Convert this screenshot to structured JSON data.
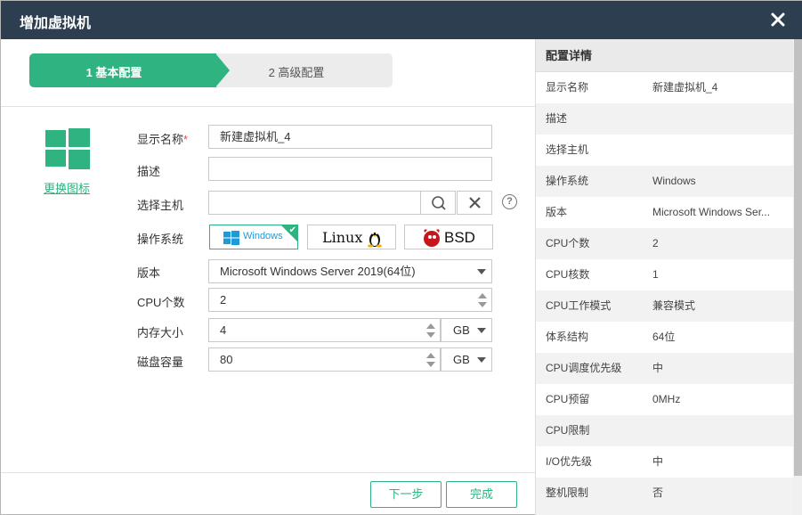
{
  "window": {
    "title": "增加虚拟机"
  },
  "steps": [
    {
      "label": "1 基本配置",
      "active": true
    },
    {
      "label": "2 高级配置",
      "active": false
    }
  ],
  "icon": {
    "name": "windows-icon",
    "change_label": "更换图标"
  },
  "form": {
    "display_name": {
      "label": "显示名称",
      "required_mark": "*",
      "value": "新建虚拟机_4"
    },
    "description": {
      "label": "描述",
      "value": ""
    },
    "host": {
      "label": "选择主机",
      "value": "",
      "help": "?"
    },
    "os": {
      "label": "操作系统",
      "options": [
        {
          "name": "Windows",
          "selected": true
        },
        {
          "name": "Linux",
          "selected": false
        },
        {
          "name": "BSD",
          "selected": false
        }
      ]
    },
    "version": {
      "label": "版本",
      "value": "Microsoft Windows Server 2019(64位)"
    },
    "cpu_count": {
      "label": "CPU个数",
      "value": "2"
    },
    "memory": {
      "label": "内存大小",
      "value": "4",
      "unit": "GB"
    },
    "disk": {
      "label": "磁盘容量",
      "value": "80",
      "unit": "GB"
    }
  },
  "footer": {
    "next_label": "下一步",
    "finish_label": "完成"
  },
  "details": {
    "title": "配置详情",
    "rows": [
      {
        "k": "显示名称",
        "v": "新建虚拟机_4"
      },
      {
        "k": "描述",
        "v": ""
      },
      {
        "k": "选择主机",
        "v": ""
      },
      {
        "k": "操作系统",
        "v": "Windows"
      },
      {
        "k": "版本",
        "v": "Microsoft Windows Ser..."
      },
      {
        "k": "CPU个数",
        "v": "2"
      },
      {
        "k": "CPU核数",
        "v": "1"
      },
      {
        "k": "CPU工作模式",
        "v": "兼容模式"
      },
      {
        "k": "体系结构",
        "v": "64位"
      },
      {
        "k": "CPU调度优先级",
        "v": "中"
      },
      {
        "k": "CPU预留",
        "v": "0MHz"
      },
      {
        "k": "CPU限制",
        "v": ""
      },
      {
        "k": "I/O优先级",
        "v": "中"
      },
      {
        "k": "整机限制",
        "v": "否"
      }
    ]
  },
  "colors": {
    "accent": "#2fb380",
    "titlebar": "#2d3e50"
  }
}
